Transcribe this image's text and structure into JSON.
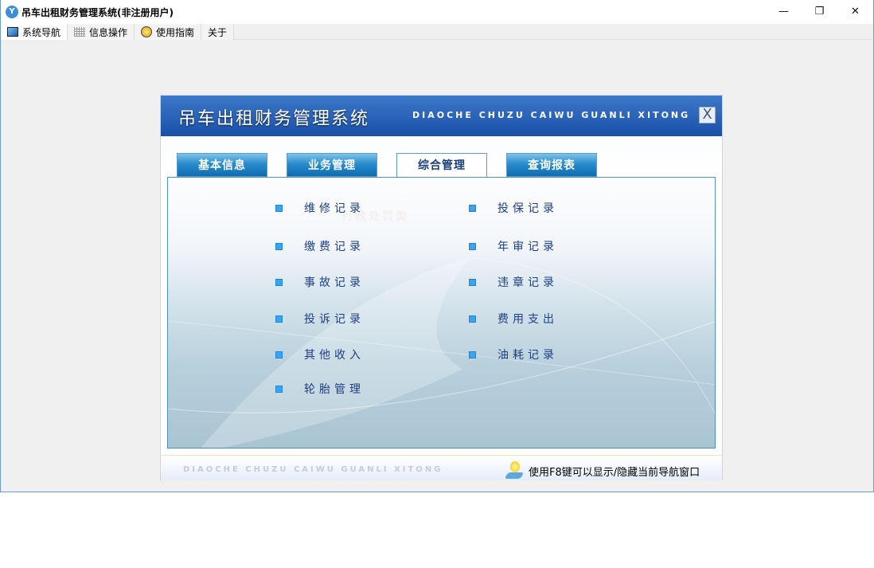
{
  "window": {
    "title": "吊车出租财务管理系统(非注册用户)",
    "controls": {
      "minimize": "—",
      "maximize": "❐",
      "close": "✕"
    }
  },
  "menu_tabs": [
    {
      "label": "系统导航"
    },
    {
      "label": "信息操作"
    },
    {
      "label": "使用指南"
    },
    {
      "label": "关于"
    }
  ],
  "panel": {
    "title_cn": "吊车出租财务管理系统",
    "title_en": "DIAOCHE CHUZU CAIWU GUANLI XITONG",
    "close": "X",
    "tabs": [
      {
        "label": "基本信息"
      },
      {
        "label": "业务管理"
      },
      {
        "label": "综合管理"
      },
      {
        "label": "查询报表"
      }
    ],
    "ghost_text": "行政处罚类",
    "items": [
      {
        "label": "维修记录"
      },
      {
        "label": "投保记录"
      },
      {
        "label": "缴费记录"
      },
      {
        "label": "年审记录"
      },
      {
        "label": "事故记录"
      },
      {
        "label": "违章记录"
      },
      {
        "label": "投诉记录"
      },
      {
        "label": "费用支出"
      },
      {
        "label": "其他收入"
      },
      {
        "label": "油耗记录"
      },
      {
        "label": "轮胎管理"
      }
    ],
    "footer_en": "DIAOCHE CHUZU CAIWU GUANLI XITONG",
    "footer_tip": "使用F8键可以显示/隐藏当前导航窗口"
  }
}
